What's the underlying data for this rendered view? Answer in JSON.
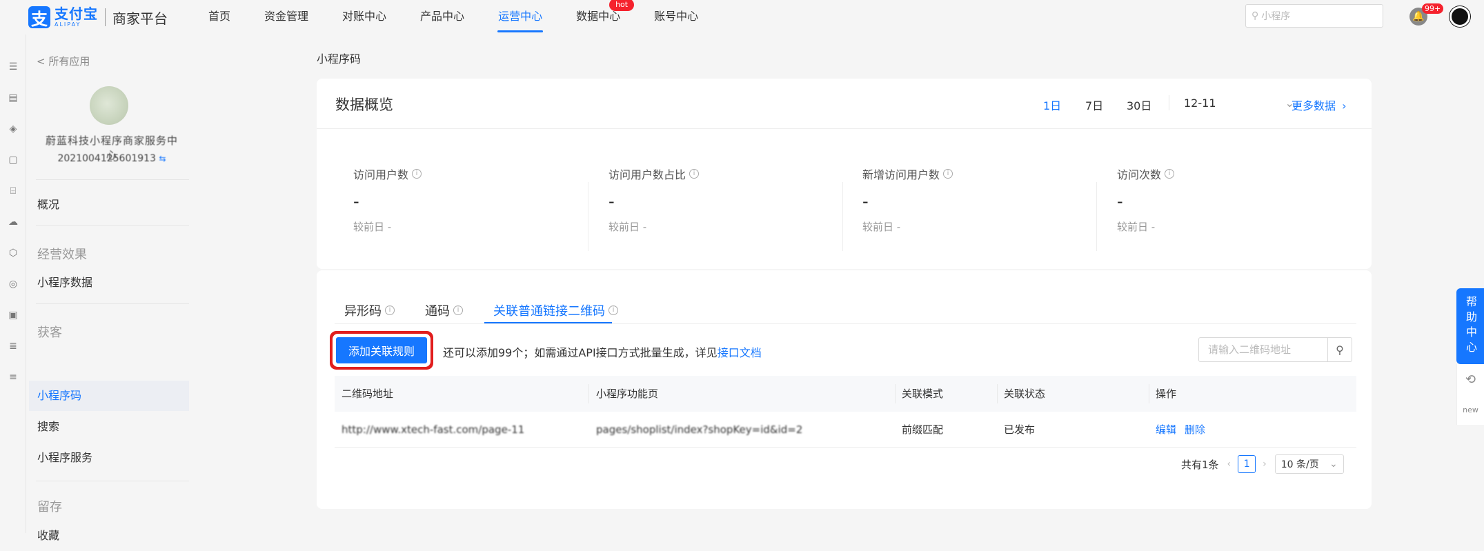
{
  "header": {
    "logo_cn": "支付宝",
    "logo_en": "ALIPAY",
    "platform": "商家平台",
    "nav": [
      {
        "label": "首页"
      },
      {
        "label": "资金管理"
      },
      {
        "label": "对账中心"
      },
      {
        "label": "产品中心"
      },
      {
        "label": "运营中心",
        "active": true
      },
      {
        "label": "数据中心",
        "badge": "hot"
      },
      {
        "label": "账号中心"
      }
    ],
    "search_placeholder": "小程序",
    "notification_count": "99+",
    "accent_color": "#1677ff"
  },
  "sidebar": {
    "back_label": "< 所有应用",
    "app_name": "蔚蓝科技小程序商家服务中心",
    "app_id": "2021004125601913",
    "overview": "概况",
    "groups": [
      {
        "title": "经营效果",
        "items": [
          {
            "label": "小程序数据"
          }
        ]
      },
      {
        "title": "获客",
        "items": [
          {
            "label": "小程序码",
            "active": true
          },
          {
            "label": "搜索"
          },
          {
            "label": "小程序服务"
          }
        ]
      },
      {
        "title": "留存",
        "items": [
          {
            "label": "收藏"
          }
        ]
      }
    ]
  },
  "breadcrumb": "小程序码",
  "overview": {
    "title": "数据概览",
    "ranges": [
      "1日",
      "7日",
      "30日"
    ],
    "active_range": "1日",
    "date": "12-11",
    "more_label": "更多数据",
    "metrics": [
      {
        "label": "访问用户数",
        "value": "-",
        "compare": "较前日 -"
      },
      {
        "label": "访问用户数占比",
        "value": "-",
        "compare": "较前日 -"
      },
      {
        "label": "新增访问用户数",
        "value": "-",
        "compare": "较前日 -"
      },
      {
        "label": "访问次数",
        "value": "-",
        "compare": "较前日 -"
      }
    ]
  },
  "qr": {
    "tabs": [
      {
        "label": "异形码"
      },
      {
        "label": "通码"
      },
      {
        "label": "关联普通链接二维码",
        "active": true
      }
    ],
    "add_button": "添加关联规则",
    "hint_text": "还可以添加99个；如需通过API接口方式批量生成，详见",
    "hint_link": "接口文档",
    "search_placeholder": "请输入二维码地址",
    "columns": [
      "二维码地址",
      "小程序功能页",
      "关联模式",
      "关联状态",
      "操作"
    ],
    "rows": [
      {
        "url": "http://www.xtech-fast.com/page-11",
        "page": "pages/shoplist/index?shopKey=id&id=2",
        "mode": "前缀匹配",
        "status": "已发布",
        "actions": [
          "编辑",
          "删除"
        ]
      }
    ],
    "pagination": {
      "total": "共有1条",
      "current": "1",
      "page_size": "10 条/页"
    }
  },
  "help": {
    "label": "帮助中心",
    "tools": [
      "refresh-icon",
      "new-feature-icon"
    ]
  }
}
